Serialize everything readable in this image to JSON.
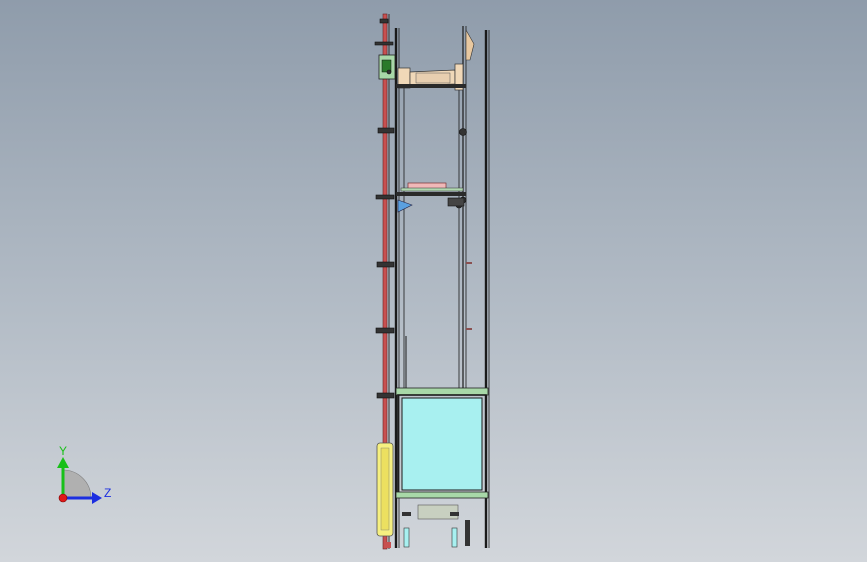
{
  "triad": {
    "y_label": "Y",
    "z_label": "Z",
    "y_color": "#18c018",
    "z_color": "#1c2ee0",
    "x_color": "#e01818"
  },
  "colors": {
    "background_top": "#8f9cab",
    "background_bottom": "#d2d6db",
    "frame": "#1a1a1a",
    "rail": "#c85050",
    "cabin_fill": "#a8f0f0",
    "base_green": "#a8d8a8",
    "side_panel": "#f6f080",
    "pink_part": "#f0b8b8",
    "roller": "#f0d8b8",
    "bracket_blue": "#5aa0e0"
  }
}
